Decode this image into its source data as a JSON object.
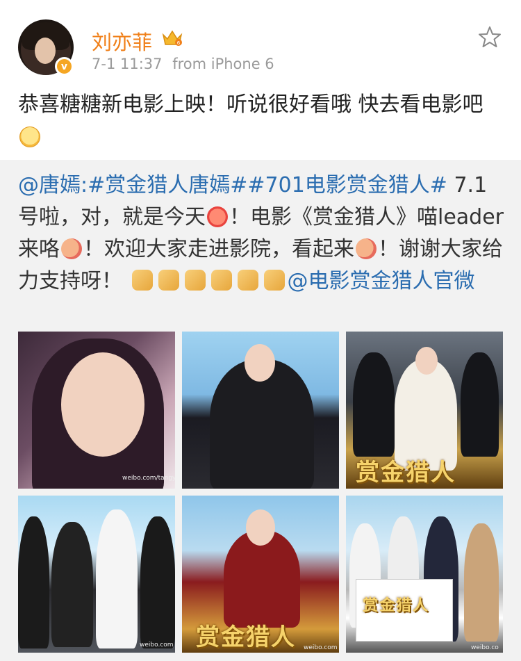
{
  "author": {
    "name": "刘亦菲",
    "time": "7-1 11:37",
    "source": "from iPhone 6",
    "verified_mark": "v"
  },
  "post": {
    "text": "恭喜糖糖新电影上映！听说很好看哦 快去看电影吧"
  },
  "repost": {
    "mention": "@唐嫣",
    "colon": ":",
    "hashtag1": "#赏金猎人唐嫣#",
    "hashtag2": "#701电影赏金猎人#",
    "text1": " 7.1号啦，对，就是今天",
    "text2": "！电影《赏金猎人》喵leader来咯",
    "text3": "！欢迎大家走进影院，看起来",
    "text4": "！谢谢大家给力支持呀！",
    "mention2": "@电影赏金猎人官微",
    "photos": [
      {
        "title": "",
        "watermark": "weibo.com/tangyan"
      },
      {
        "title": "",
        "watermark": ""
      },
      {
        "title": "赏金猎人",
        "watermark": ""
      },
      {
        "title": "",
        "watermark": "weibo.com"
      },
      {
        "title": "赏金猎人",
        "watermark": "weibo.com"
      },
      {
        "title": "赏金猎人",
        "watermark": "weibo.co"
      }
    ]
  },
  "colors": {
    "name": "#f07f18",
    "link": "#2b6db0",
    "meta": "#9a9a9a",
    "repost_bg": "#f2f2f2"
  }
}
